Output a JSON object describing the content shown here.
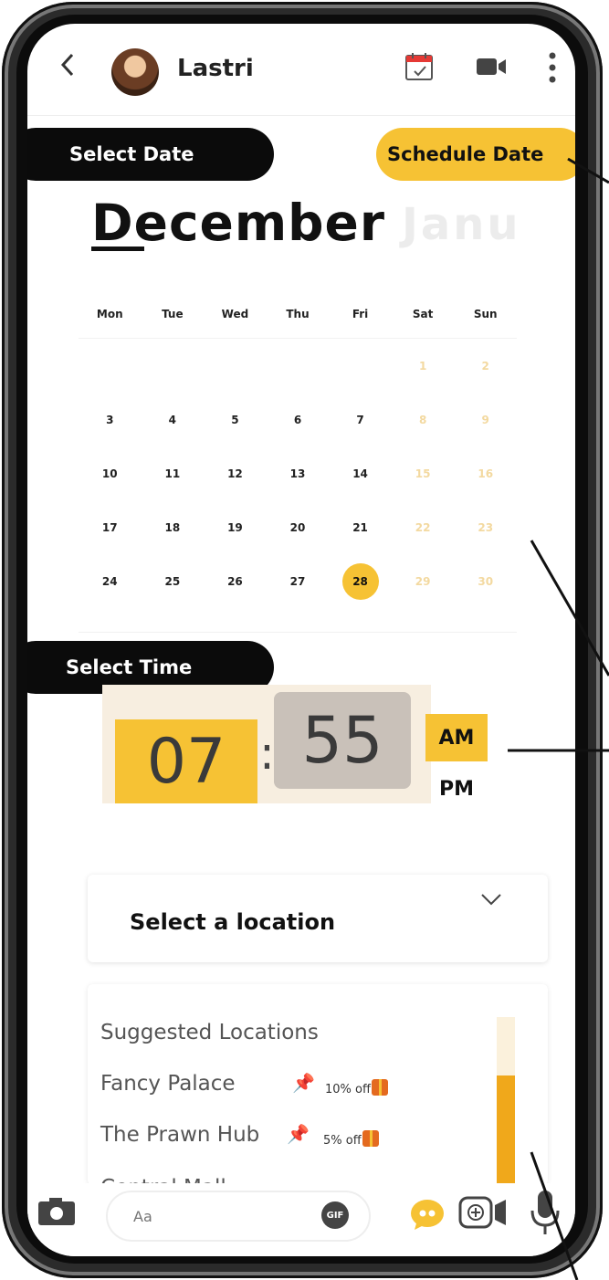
{
  "header": {
    "contact_name": "Lastri"
  },
  "date_section": {
    "label": "Select Date",
    "schedule_button": "Schedule Date",
    "month": "December",
    "next_month_preview": "Janu",
    "weekdays": [
      "Mon",
      "Tue",
      "Wed",
      "Thu",
      "Fri",
      "Sat",
      "Sun"
    ],
    "weeks": [
      [
        "",
        "",
        "",
        "",
        "",
        "1",
        "2"
      ],
      [
        "3",
        "4",
        "5",
        "6",
        "7",
        "8",
        "9"
      ],
      [
        "10",
        "11",
        "12",
        "13",
        "14",
        "15",
        "16"
      ],
      [
        "17",
        "18",
        "19",
        "20",
        "21",
        "22",
        "23"
      ],
      [
        "24",
        "25",
        "26",
        "27",
        "28",
        "29",
        "30"
      ]
    ],
    "selected_day": "28"
  },
  "time_section": {
    "label": "Select Time",
    "hour": "07",
    "separator": ":",
    "minute": "55",
    "am": "AM",
    "pm": "PM",
    "selected_period": "AM"
  },
  "location": {
    "select_label": "Select a location",
    "suggested_title": "Suggested Locations",
    "suggestions": [
      {
        "name": "Fancy Palace",
        "offer": "10% off"
      },
      {
        "name": "The Prawn Hub",
        "offer": "5% off"
      },
      {
        "name": "Central Mall",
        "offer": ""
      }
    ]
  },
  "composer": {
    "placeholder": "Aa",
    "gif_label": "GIF"
  },
  "colors": {
    "accent_yellow": "#f6c234",
    "scroll_orange": "#f0a81b",
    "pill_black": "#0b0b0b"
  },
  "icons": [
    "back-icon",
    "calendar-icon",
    "video-call-icon",
    "more-icon",
    "chevron-down-icon",
    "pin-icon",
    "gift-icon",
    "camera-icon",
    "gif-icon",
    "quote-icon",
    "camera-effect-icon",
    "mic-icon"
  ]
}
